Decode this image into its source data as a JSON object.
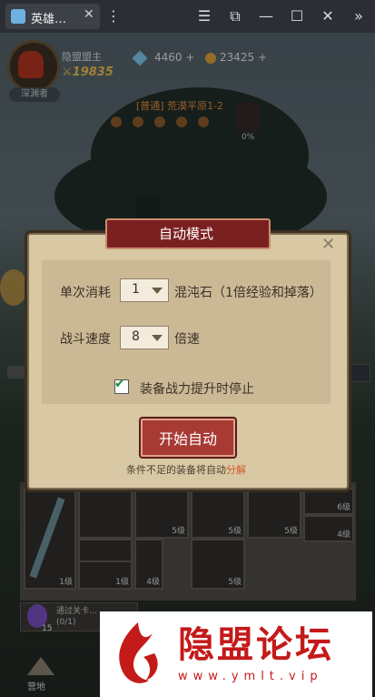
{
  "window": {
    "tab_title": "英雄…",
    "tab_close": "✕",
    "controls": [
      "☰",
      "⧉",
      "—",
      "☐",
      "✕",
      "»"
    ]
  },
  "hud": {
    "player_name": "隐盟盟主",
    "player_power": "⚔19835",
    "rank_tag": "深渊者",
    "gems": "4460",
    "gold": "23425",
    "plus": "+",
    "stage": "[普通] 荒漠平原1-2",
    "boss_progress": "0%"
  },
  "modal": {
    "title": "自动模式",
    "close": "✕",
    "cost_label": "单次消耗",
    "cost_value": "1",
    "cost_unit": "混沌石（1倍经验和掉落）",
    "speed_label": "战斗速度",
    "speed_value": "8",
    "speed_unit": "倍速",
    "stop_checked": true,
    "stop_label": "装备战力提升时停止",
    "check_mark": "✔",
    "start_button": "开始自动",
    "hint_prefix": "条件不足的装备将自动",
    "hint_link": "分解"
  },
  "inventory": {
    "quantities": [
      "1级",
      "1级",
      "5级",
      "5级",
      "5级",
      "6级",
      "4级",
      "5级",
      "4级",
      "1级"
    ],
    "quest_text": "通过关卡…",
    "quest_count": "(0/1)",
    "quest_num": "15",
    "camp_label": "营地"
  },
  "watermark": {
    "text": "隐盟论坛",
    "url": "www.ymlt.vip"
  },
  "colors": {
    "modal_bg": "#d8c8a4",
    "title_bar": "#7b2020",
    "start_button": "#a83a34",
    "watermark": "#c41a1a"
  }
}
